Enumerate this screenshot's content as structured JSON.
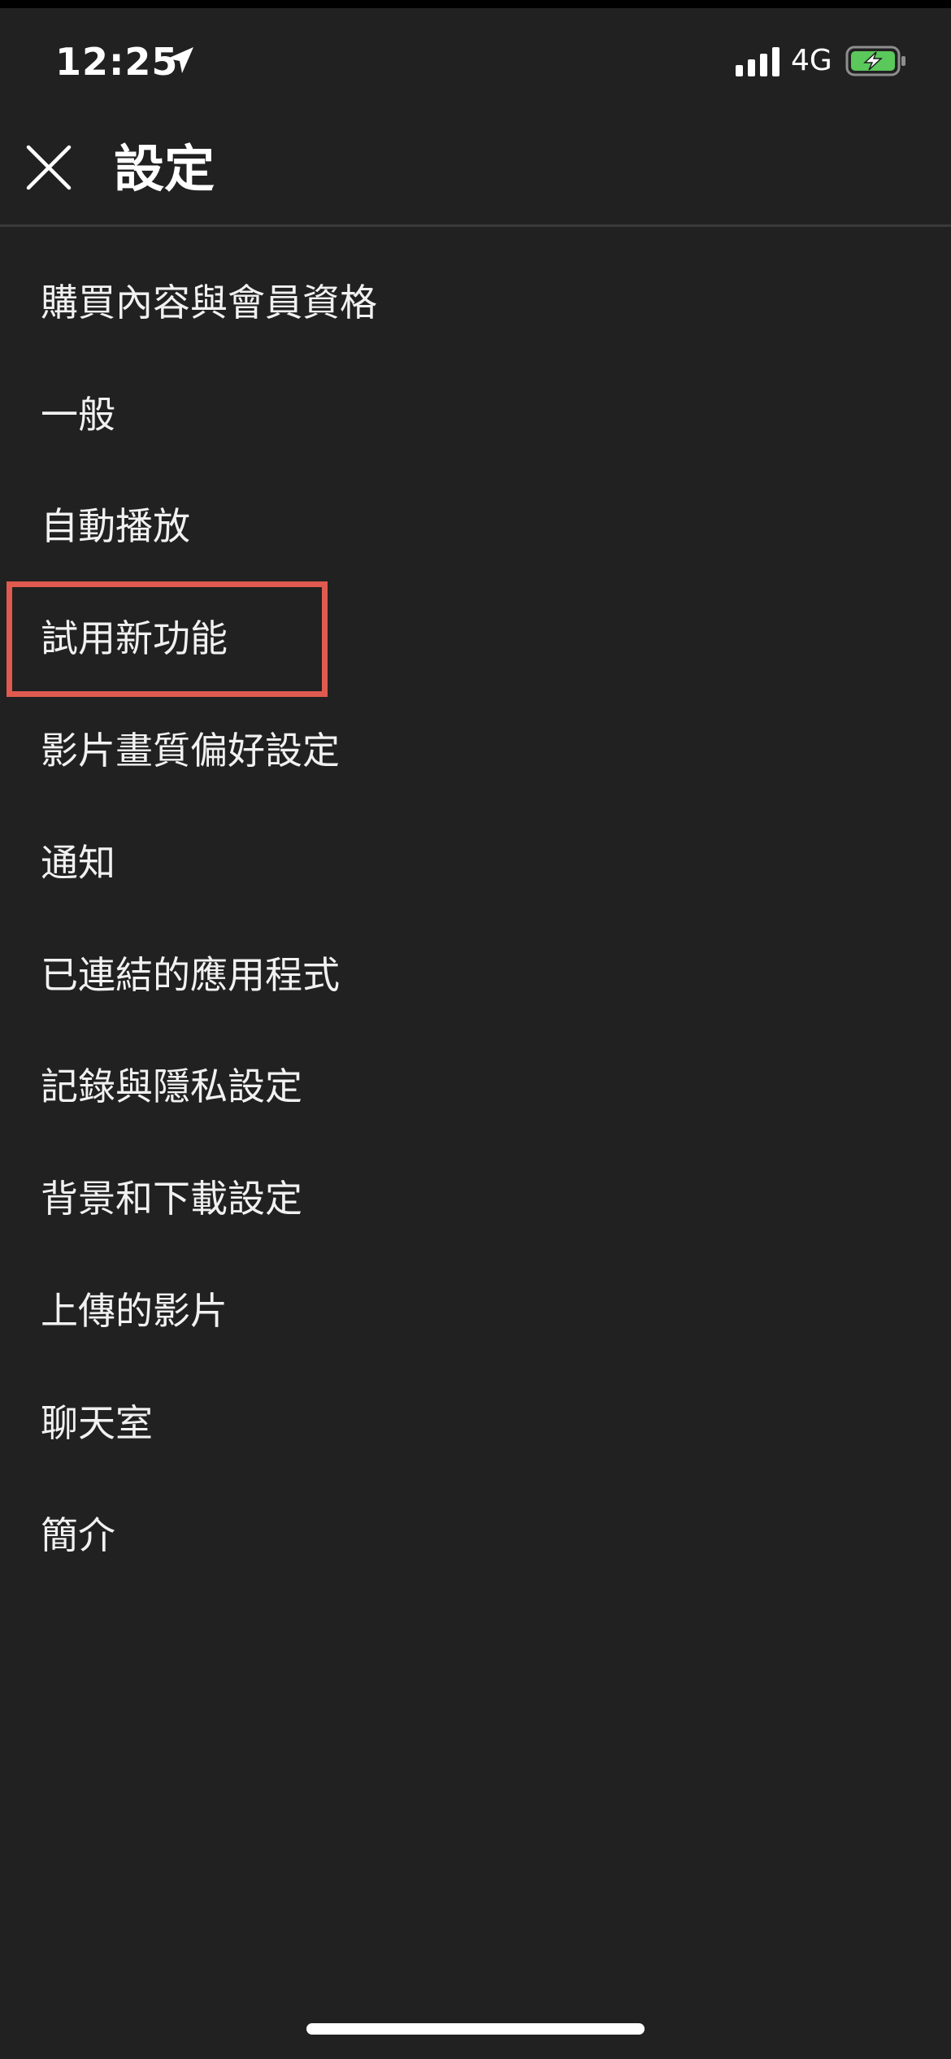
{
  "status_bar": {
    "time": "12:25",
    "network": "4G",
    "icons": {
      "location": "location-arrow-icon",
      "signal": "signal-strength-icon",
      "battery": "battery-charging-icon"
    },
    "battery_color": "#5ac85a"
  },
  "header": {
    "title": "設定",
    "close_icon": "close-icon"
  },
  "menu": {
    "items": [
      {
        "label": "購買內容與會員資格"
      },
      {
        "label": "一般"
      },
      {
        "label": "自動播放"
      },
      {
        "label": "試用新功能"
      },
      {
        "label": "影片畫質偏好設定"
      },
      {
        "label": "通知"
      },
      {
        "label": "已連結的應用程式"
      },
      {
        "label": "記錄與隱私設定"
      },
      {
        "label": "背景和下載設定"
      },
      {
        "label": "上傳的影片"
      },
      {
        "label": "聊天室"
      },
      {
        "label": "簡介"
      }
    ],
    "highlighted_item": "試用新功能",
    "highlight_color": "#e05a50"
  },
  "colors": {
    "background": "#212121",
    "text": "#f1f1f1",
    "divider": "#3a3a3a"
  }
}
